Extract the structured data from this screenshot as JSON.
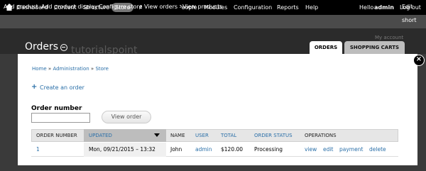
{
  "toolbar": {
    "items": [
      "Dashboard",
      "Content",
      "Structure",
      "Store",
      "Appearance",
      "People",
      "Modules",
      "Configuration",
      "Reports",
      "Help"
    ],
    "greeting_prefix": "Hello",
    "username": "admin",
    "logout": "Log out"
  },
  "shortcuts": {
    "items": [
      "Add product",
      "Add product display",
      "Configure store",
      "View orders",
      "View products"
    ],
    "edit": "Edit short"
  },
  "header": {
    "title": "Orders",
    "watermark": "tutorialspoint",
    "my_account": "My account",
    "tabs": [
      "ORDERS",
      "SHOPPING CARTS"
    ]
  },
  "breadcrumb": [
    "Home",
    "Administration",
    "Store"
  ],
  "breadcrumb_sep": "»",
  "create_order": "Create an order",
  "order_number_label": "Order number",
  "order_number_value": "",
  "view_order_button": "View order",
  "table": {
    "headers": [
      "ORDER NUMBER",
      "UPDATED",
      "NAME",
      "USER",
      "TOTAL",
      "ORDER STATUS",
      "OPERATIONS"
    ],
    "rows": [
      {
        "order_number": "1",
        "updated": "Mon, 09/21/2015 – 13:32",
        "name": "John",
        "user": "admin",
        "total": "$120.00",
        "status": "Processing",
        "operations": [
          "view",
          "edit",
          "payment",
          "delete"
        ]
      }
    ]
  },
  "colors": {
    "toolbar_bg": "#000000",
    "link": "#2a6fa8",
    "active_pill": "#777777"
  },
  "icons": {
    "home": "home-icon",
    "close": "close-icon",
    "sort": "sort-desc-icon",
    "plus": "plus-icon"
  }
}
